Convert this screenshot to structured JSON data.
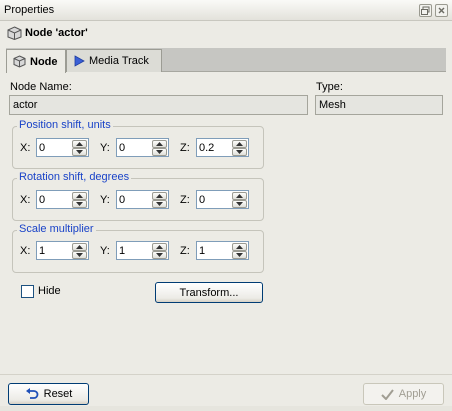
{
  "window": {
    "title": "Properties",
    "icons": [
      "restore-icon",
      "close-icon"
    ]
  },
  "header": {
    "title": "Node 'actor'",
    "icon": "cube-icon"
  },
  "tabs": [
    {
      "label": "Node",
      "icon": "cube-icon",
      "active": true
    },
    {
      "label": "Media Track",
      "icon": "play-icon",
      "active": false
    }
  ],
  "node_name": {
    "label": "Node Name:",
    "value": "actor"
  },
  "type": {
    "label": "Type:",
    "value": "Mesh"
  },
  "position": {
    "title": "Position shift, units",
    "x_label": "X:",
    "x": "0",
    "y_label": "Y:",
    "y": "0",
    "z_label": "Z:",
    "z": "0.2"
  },
  "rotation": {
    "title": "Rotation shift, degrees",
    "x_label": "X:",
    "x": "0",
    "y_label": "Y:",
    "y": "0",
    "z_label": "Z:",
    "z": "0"
  },
  "scale": {
    "title": "Scale multiplier",
    "x_label": "X:",
    "x": "1",
    "y_label": "Y:",
    "y": "1",
    "z_label": "Z:",
    "z": "1"
  },
  "hide": {
    "label": "Hide",
    "checked": false
  },
  "transform_button": {
    "label": "Transform..."
  },
  "reset_button": {
    "label": "Reset",
    "icon": "undo-arrow-icon"
  },
  "apply_button": {
    "label": "Apply",
    "icon": "checkmark-icon",
    "enabled": false
  },
  "colors": {
    "group_title": "#1a43c8",
    "background": "#ecebe5",
    "focus_border": "#003c74"
  }
}
